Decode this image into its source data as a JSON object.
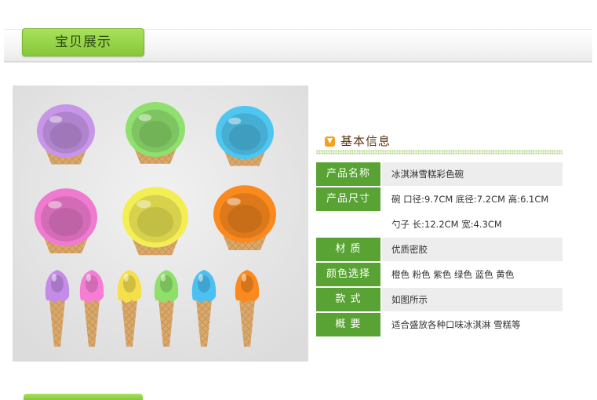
{
  "header": {
    "title": "宝贝展示"
  },
  "photo": {
    "description_icon": "ice-cream-bowls-and-spoons-image",
    "bowl_colors": [
      "#c896e8",
      "#8fe06e",
      "#4fc6ef",
      "#f07ad0",
      "#f4ee55",
      "#fb8a1e"
    ],
    "spoon_colors": [
      "#c48ce8",
      "#f57ed4",
      "#f4e04a",
      "#8ee06a",
      "#4cc0f2",
      "#fb8a1e"
    ]
  },
  "info": {
    "title": "基本信息",
    "rows": [
      {
        "label": "产品名称",
        "value": "冰淇淋雪糕彩色碗"
      },
      {
        "label": "产品尺寸",
        "value": "碗 口径:9.7CM 底径:7.2CM 高:6.1CM"
      },
      {
        "label": "",
        "value": "勺子 长:12.2CM 宽:4.3CM"
      },
      {
        "label": "材   质",
        "value": "优质密胶"
      },
      {
        "label": "颜色选择",
        "value": "橙色 粉色 紫色 绿色 蓝色 黄色"
      },
      {
        "label": "款   式",
        "value": "如图所示"
      },
      {
        "label": "概   要",
        "value": "适合盛放各种口味冰淇淋 雪糕等"
      }
    ]
  }
}
